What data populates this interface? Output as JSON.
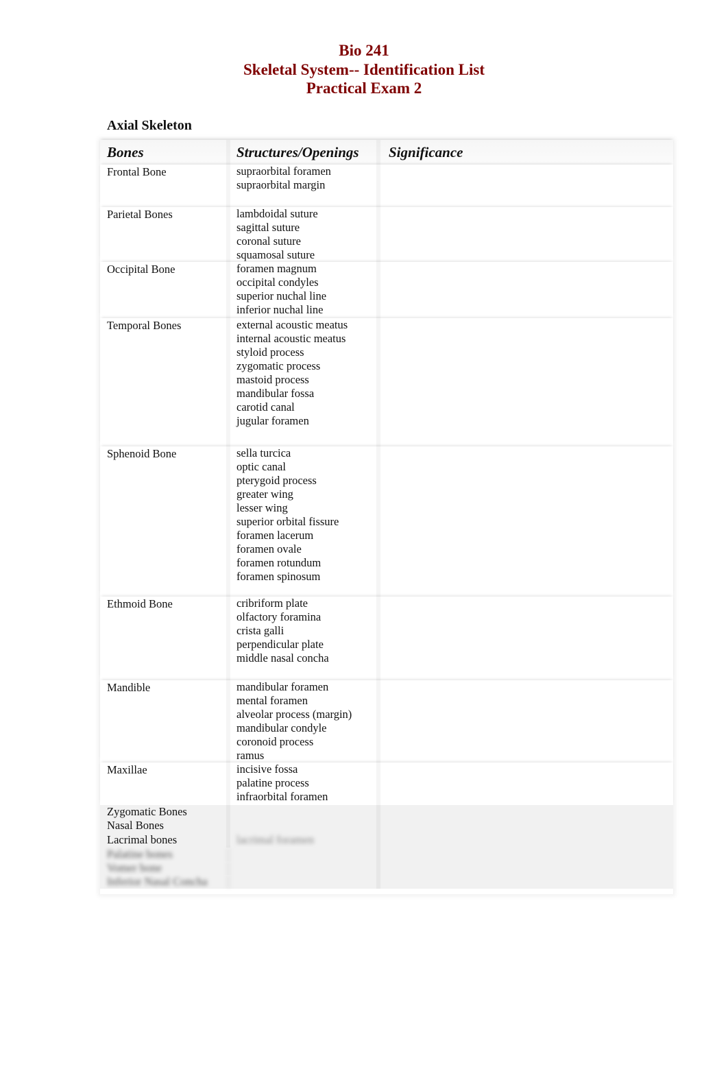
{
  "header": {
    "course": "Bio 241",
    "title": "Skeletal System-- Identification List",
    "subtitle": "Practical Exam 2"
  },
  "section_title": "Axial Skeleton",
  "table": {
    "columns": [
      "Bones",
      "Structures/Openings",
      "Significance"
    ],
    "rows": [
      {
        "bone": "Frontal Bone",
        "structures": [
          "supraorbital foramen",
          "supraorbital margin"
        ],
        "significance": ""
      },
      {
        "bone": "Parietal Bones",
        "structures": [
          "lambdoidal suture",
          "sagittal suture",
          "coronal suture",
          "squamosal suture"
        ],
        "significance": ""
      },
      {
        "bone": "Occipital Bone",
        "structures": [
          "foramen magnum",
          "occipital condyles",
          "superior nuchal line",
          "inferior nuchal line"
        ],
        "significance": ""
      },
      {
        "bone": "Temporal Bones",
        "structures": [
          "external acoustic meatus",
          "internal acoustic meatus",
          "styloid process",
          "zygomatic process",
          "mastoid process",
          "mandibular fossa",
          "carotid canal",
          "jugular foramen"
        ],
        "significance": ""
      },
      {
        "bone": "Sphenoid Bone",
        "structures": [
          "sella turcica",
          "optic canal",
          "pterygoid process",
          "greater wing",
          "lesser wing",
          "superior orbital fissure",
          "foramen lacerum",
          "foramen ovale",
          "foramen rotundum",
          "foramen spinosum"
        ],
        "significance": ""
      },
      {
        "bone": "Ethmoid Bone",
        "structures": [
          "cribriform plate",
          "olfactory foramina",
          "crista galli",
          "perpendicular plate",
          "middle nasal concha"
        ],
        "significance": ""
      },
      {
        "bone": "Mandible",
        "structures": [
          "mandibular foramen",
          "mental foramen",
          "alveolar process (margin)",
          "mandibular condyle",
          "coronoid process",
          "ramus"
        ],
        "significance": ""
      },
      {
        "bone": "Maxillae",
        "structures": [
          "incisive fossa",
          "palatine process",
          "infraorbital foramen"
        ],
        "significance": ""
      },
      {
        "bone": "Zygomatic Bones",
        "structures": [],
        "significance": ""
      },
      {
        "bone": "Nasal Bones",
        "structures": [],
        "significance": ""
      },
      {
        "bone": "Lacrimal bones",
        "structures": [
          "[blurred]"
        ],
        "significance": ""
      }
    ],
    "obscured_rows": 3
  }
}
